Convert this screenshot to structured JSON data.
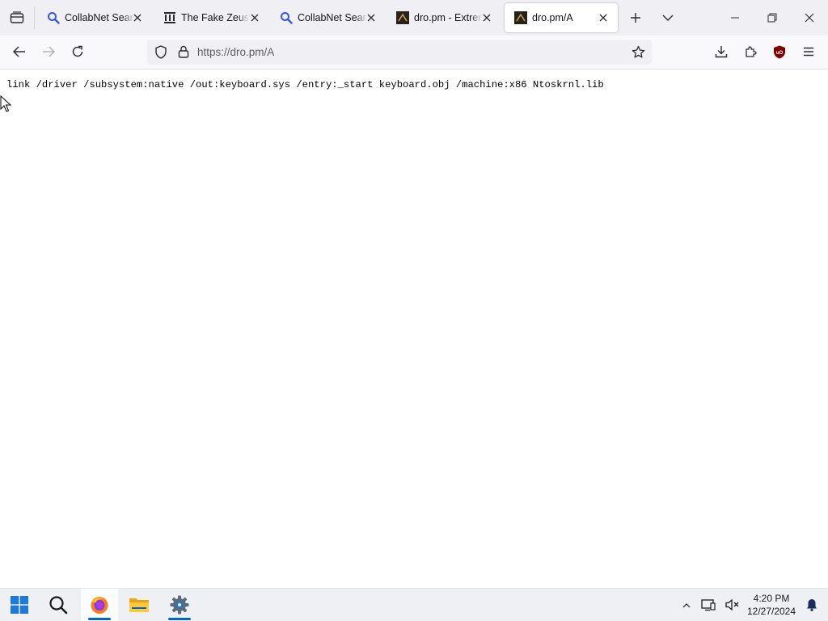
{
  "browser": {
    "tabs": [
      {
        "title": "CollabNet Search",
        "favicon": "search-icon",
        "active": false
      },
      {
        "title": "The Fake Zeus Wiki",
        "favicon": "library-icon",
        "active": false
      },
      {
        "title": "CollabNet Search",
        "favicon": "search-icon",
        "active": false
      },
      {
        "title": "dro.pm - Extreme",
        "favicon": "dro-pm-icon",
        "active": false
      },
      {
        "title": "dro.pm/A",
        "favicon": "dro-pm-icon",
        "active": true
      }
    ],
    "url": "https://dro.pm/A"
  },
  "page": {
    "text": "link /driver /subsystem:native /out:keyboard.sys /entry:_start keyboard.obj /machine:x86 Ntoskrnl.lib"
  },
  "taskbar": {
    "pinned": [
      "start-button",
      "search-button",
      "firefox-app",
      "file-explorer-app",
      "settings-app"
    ],
    "clock": {
      "time": "4:20 PM",
      "date": "12/27/2024"
    }
  },
  "colors": {
    "accent": "#0067c0",
    "tabbar": "#f0f0f4",
    "ublock": "#800000"
  }
}
